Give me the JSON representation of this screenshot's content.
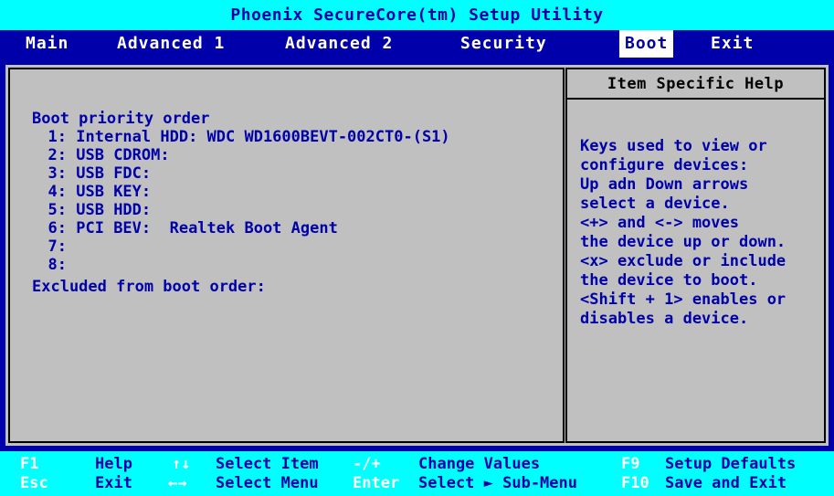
{
  "title": "Phoenix SecureCore(tm) Setup Utility",
  "menu": [
    {
      "label": "Main"
    },
    {
      "label": "Advanced 1"
    },
    {
      "label": "Advanced 2"
    },
    {
      "label": "Security"
    },
    {
      "label": "Boot"
    },
    {
      "label": "Exit"
    }
  ],
  "boot": {
    "heading": "Boot priority order",
    "items": [
      {
        "num": "1:",
        "label": "Internal HDD: WDC WD1600BEVT-002CT0-(S1)"
      },
      {
        "num": "2:",
        "label": "USB CDROM:"
      },
      {
        "num": "3:",
        "label": "USB FDC:"
      },
      {
        "num": "4:",
        "label": "USB KEY:"
      },
      {
        "num": "5:",
        "label": "USB HDD:"
      },
      {
        "num": "6:",
        "label": "PCI BEV:  Realtek Boot Agent"
      },
      {
        "num": "7:",
        "label": ""
      },
      {
        "num": "8:",
        "label": ""
      }
    ],
    "excluded_label": "Excluded from boot order:"
  },
  "help": {
    "title": "Item Specific Help",
    "lines": [
      "Keys used to view or",
      "configure devices:",
      "Up adn Down arrows",
      "select a device.",
      "<+> and <-> moves",
      "the device up or down.",
      "<x> exclude or include",
      "the device to boot.",
      "<Shift + 1> enables or",
      "disables a device."
    ]
  },
  "status": {
    "f1": "F1",
    "help": "Help",
    "updown": "↑↓",
    "select_item": "Select Item",
    "minus_plus": "-/+",
    "change_values": "Change Values",
    "f9": "F9",
    "setup_defaults": "Setup Defaults",
    "esc": "Esc",
    "exit": "Exit",
    "leftright": "←→",
    "select_menu": "Select Menu",
    "enter": "Enter",
    "select_submenu": "Select ► Sub-Menu",
    "f10": "F10",
    "save_exit": "Save and Exit"
  }
}
